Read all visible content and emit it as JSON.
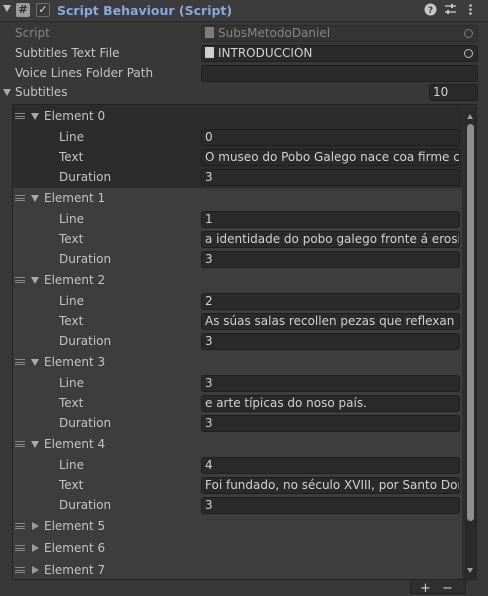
{
  "header": {
    "title": "Script Behaviour (Script)",
    "script_icon_glyph": "#",
    "enabled_glyph": "✓",
    "icons": [
      "help-icon",
      "presets-icon",
      "more-icon"
    ]
  },
  "fields": {
    "script": {
      "label": "Script",
      "value": "SubsMetodoDaniel"
    },
    "subtitles_file": {
      "label": "Subtitles Text File",
      "value": "INTRODUCCIÓN"
    },
    "voice_folder": {
      "label": "Voice Lines Folder Path",
      "value": ""
    }
  },
  "subtitles": {
    "label": "Subtitles",
    "size": "10",
    "prop_labels": {
      "line": "Line",
      "text": "Text",
      "duration": "Duration"
    },
    "elements": [
      {
        "name": "Element 0",
        "line": "0",
        "text": "O museo do Pobo Galego nace coa firme cor",
        "duration": "3",
        "expanded": true
      },
      {
        "name": "Element 1",
        "line": "1",
        "text": "a identidade do pobo galego fronte á erosiór",
        "duration": "3",
        "expanded": true
      },
      {
        "name": "Element 2",
        "line": "2",
        "text": "As súas salas recollen pezas que reflexan a t",
        "duration": "3",
        "expanded": true
      },
      {
        "name": "Element 3",
        "line": "3",
        "text": "e arte típicas do noso país.",
        "duration": "3",
        "expanded": true
      },
      {
        "name": "Element 4",
        "line": "4",
        "text": "Foi fundado, no século XVIII, por Santo Domi",
        "duration": "3",
        "expanded": true
      },
      {
        "name": "Element 5",
        "expanded": false
      },
      {
        "name": "Element 6",
        "expanded": false
      },
      {
        "name": "Element 7",
        "expanded": false
      }
    ]
  },
  "footer": {
    "add_label": "+",
    "remove_label": "−"
  },
  "colors": {
    "panel_bg": "#383838",
    "title_blue": "#86a9e0",
    "field_bg": "#2a2a2a"
  }
}
